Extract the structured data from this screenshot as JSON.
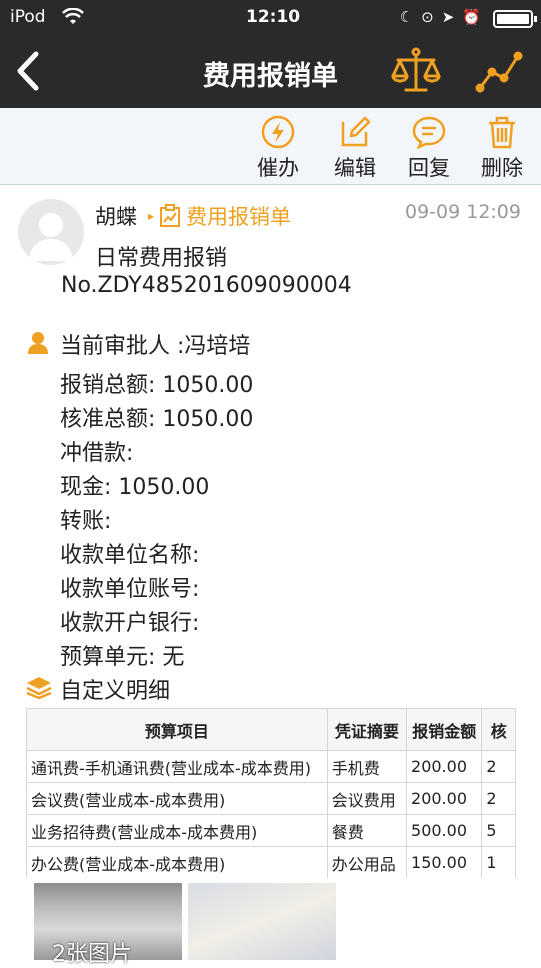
{
  "status_bar": {
    "carrier": "iPod",
    "time": "12:10"
  },
  "nav": {
    "title": "费用报销单"
  },
  "toolbar": {
    "remind": "催办",
    "edit": "编辑",
    "reply": "回复",
    "delete": "删除"
  },
  "message": {
    "sender": "胡蝶",
    "form_name": "费用报销单",
    "timestamp": "09-09 12:09",
    "subtitle": "日常费用报销",
    "doc_no": "No.ZDY485201609090004"
  },
  "approver": "当前审批人 :冯培培",
  "fields": [
    "报销总额: 1050.00",
    "核准总额: 1050.00",
    "冲借款:",
    "现金: 1050.00",
    "转账:",
    "收款单位名称:",
    "收款单位账号:",
    "收款开户银行:",
    "预算单元: 无"
  ],
  "detail": {
    "title": "自定义明细",
    "headers": [
      "预算项目",
      "凭证摘要",
      "报销金额",
      "核"
    ],
    "rows": [
      [
        "通讯费-手机通讯费(营业成本-成本费用)",
        "手机费",
        "200.00",
        "2"
      ],
      [
        "会议费(营业成本-成本费用)",
        "会议费用",
        "200.00",
        "2"
      ],
      [
        "业务招待费(营业成本-成本费用)",
        "餐费",
        "500.00",
        "5"
      ],
      [
        "办公费(营业成本-成本费用)",
        "办公用品",
        "150.00",
        "1"
      ]
    ]
  },
  "images": {
    "count_label": "2张图片"
  },
  "colors": {
    "accent": "#f0a020",
    "dark_bar": "#2a2a2a",
    "toolbar_bg": "#f2f6fb"
  }
}
